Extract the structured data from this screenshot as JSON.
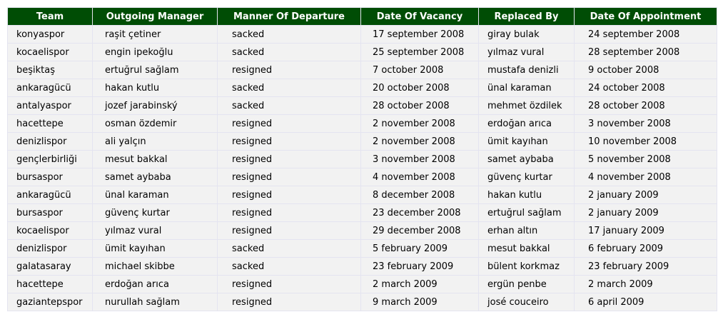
{
  "table": {
    "columns": [
      "Team",
      "Outgoing Manager",
      "Manner Of Departure",
      "Date Of Vacancy",
      "Replaced By",
      "Date Of Appointment"
    ],
    "rows": [
      [
        "konyaspor",
        "raşit çetiner",
        "sacked",
        "17 september 2008",
        "giray bulak",
        "24 september 2008"
      ],
      [
        "kocaelispor",
        "engin ipekoğlu",
        "sacked",
        "25 september 2008",
        "yılmaz vural",
        "28 september 2008"
      ],
      [
        "beşiktaş",
        "ertuğrul sağlam",
        "resigned",
        "7 october 2008",
        "mustafa denizli",
        "9 october 2008"
      ],
      [
        "ankaragücü",
        "hakan kutlu",
        "sacked",
        "20 october 2008",
        "ünal karaman",
        "24 october 2008"
      ],
      [
        "antalyaspor",
        "jozef jarabinský",
        "sacked",
        "28 october 2008",
        "mehmet özdilek",
        "28 october 2008"
      ],
      [
        "hacettepe",
        "osman özdemir",
        "resigned",
        "2 november 2008",
        "erdoğan arıca",
        "3 november 2008"
      ],
      [
        "denizlispor",
        "ali yalçın",
        "resigned",
        "2 november 2008",
        "ümit kayıhan",
        "10 november 2008"
      ],
      [
        "gençlerbirliği",
        "mesut bakkal",
        "resigned",
        "3 november 2008",
        "samet aybaba",
        "5 november 2008"
      ],
      [
        "bursaspor",
        "samet aybaba",
        "resigned",
        "4 november 2008",
        "güvenç kurtar",
        "4 november 2008"
      ],
      [
        "ankaragücü",
        "ünal karaman",
        "resigned",
        "8 december 2008",
        "hakan kutlu",
        "2 january 2009"
      ],
      [
        "bursaspor",
        "güvenç kurtar",
        "resigned",
        "23 december 2008",
        "ertuğrul sağlam",
        "2 january 2009"
      ],
      [
        "kocaelispor",
        "yılmaz vural",
        "resigned",
        "29 december 2008",
        "erhan altın",
        "17 january 2009"
      ],
      [
        "denizlispor",
        "ümit kayıhan",
        "sacked",
        "5 february 2009",
        "mesut bakkal",
        "6 february 2009"
      ],
      [
        "galatasaray",
        "michael skibbe",
        "sacked",
        "23 february 2009",
        "bülent korkmaz",
        "23 february 2009"
      ],
      [
        "hacettepe",
        "erdoğan arıca",
        "resigned",
        "2 march 2009",
        "ergün penbe",
        "2 march 2009"
      ],
      [
        "gaziantepspor",
        "nurullah sağlam",
        "resigned",
        "9 march 2009",
        "josé couceiro",
        "6 april 2009"
      ]
    ]
  },
  "colors": {
    "header_bg": "#004d05",
    "header_text": "#ffffff",
    "cell_bg": "#f2f2f2",
    "grid_line": "#e4e4f0"
  }
}
